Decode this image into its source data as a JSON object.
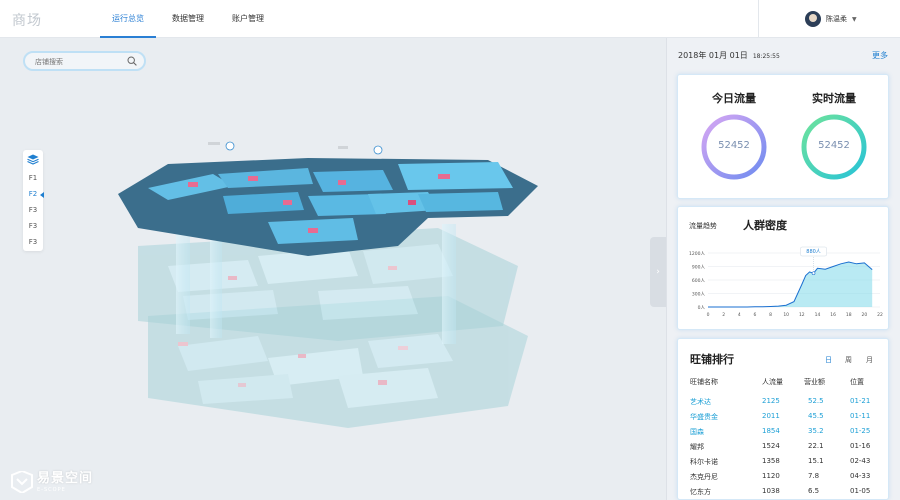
{
  "header": {
    "logo": "商场",
    "nav": [
      {
        "label": "运行总览",
        "active": true
      },
      {
        "label": "数据管理",
        "active": false
      },
      {
        "label": "账户管理",
        "active": false
      }
    ],
    "user_name": "陈温柔"
  },
  "main": {
    "search_placeholder": "店铺搜索",
    "floors": [
      {
        "label": "F1",
        "active": false
      },
      {
        "label": "F2",
        "active": true
      },
      {
        "label": "F3",
        "active": false
      },
      {
        "label": "F3",
        "active": false
      },
      {
        "label": "F3",
        "active": false
      }
    ],
    "collapse_glyph": "›",
    "brand_name": "易景空间",
    "brand_sub": "E-SCOPE"
  },
  "panel": {
    "date": "2018年 01月 01日",
    "time": "18:25:55",
    "more": "更多",
    "today_flow_label": "今日流量",
    "today_flow_value": "52452",
    "realtime_flow_label": "实时流量",
    "realtime_flow_value": "52452",
    "trend_label": "流量趋势",
    "density_label": "人群密度",
    "ranking_title": "旺铺排行",
    "periods": [
      {
        "label": "日",
        "active": true
      },
      {
        "label": "周",
        "active": false
      },
      {
        "label": "月",
        "active": false
      }
    ],
    "table": {
      "headers": [
        "旺铺名称",
        "人流量",
        "营业额",
        "位置"
      ],
      "rows": [
        {
          "name": "艺术达",
          "traffic": "2125",
          "revenue": "52.5",
          "location": "01-21",
          "highlight": true
        },
        {
          "name": "华盛贵金",
          "traffic": "2011",
          "revenue": "45.5",
          "location": "01-11",
          "highlight": true
        },
        {
          "name": "国森",
          "traffic": "1854",
          "revenue": "35.2",
          "location": "01-25",
          "highlight": true
        },
        {
          "name": "耀邦",
          "traffic": "1524",
          "revenue": "22.1",
          "location": "01-16",
          "highlight": false
        },
        {
          "name": "科尔卡诺",
          "traffic": "1358",
          "revenue": "15.1",
          "location": "02-43",
          "highlight": false
        },
        {
          "name": "杰克丹尼",
          "traffic": "1120",
          "revenue": "7.8",
          "location": "04-33",
          "highlight": false
        },
        {
          "name": "忆东方",
          "traffic": "1038",
          "revenue": "6.5",
          "location": "01-05",
          "highlight": false
        }
      ]
    }
  },
  "chart_data": {
    "type": "area",
    "x": [
      0,
      1,
      2,
      3,
      4,
      5,
      6,
      7,
      8,
      9,
      10,
      11,
      12,
      12.5,
      13,
      13.5,
      14,
      15,
      16,
      17,
      18,
      19,
      20,
      21
    ],
    "series": [
      {
        "values": [
          0,
          0,
          0,
          0,
          0,
          0,
          5,
          5,
          10,
          20,
          40,
          120,
          500,
          700,
          780,
          750,
          860,
          840,
          900,
          960,
          1000,
          960,
          980,
          830
        ]
      }
    ],
    "x_ticks": [
      "0",
      "2",
      "4",
      "6",
      "8",
      "10",
      "12",
      "14",
      "16",
      "18",
      "20",
      "22"
    ],
    "y_ticks": [
      "0人",
      "300人",
      "600人",
      "900人",
      "1200人"
    ],
    "xlim": [
      0,
      22
    ],
    "ylim": [
      0,
      1200
    ],
    "tooltip": {
      "x": 13.5,
      "label": "880人"
    },
    "colors": {
      "line": "#1a6fd0",
      "area": "#7fd8ea"
    }
  }
}
